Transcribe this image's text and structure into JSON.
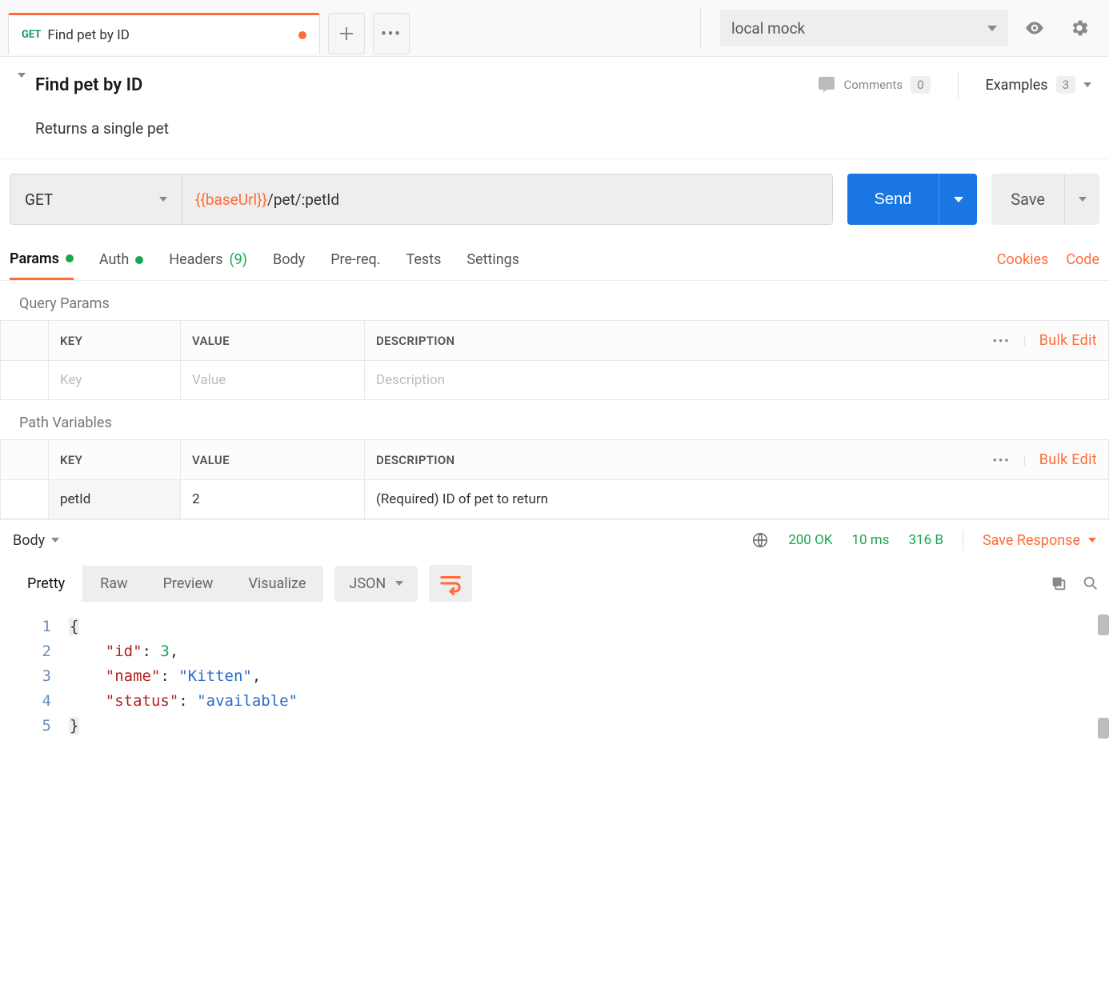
{
  "topbar": {
    "tab": {
      "method": "GET",
      "title": "Find pet by ID"
    },
    "environment": "local mock"
  },
  "title_area": {
    "title": "Find pet by ID",
    "description": "Returns a single pet",
    "comments_label": "Comments",
    "comments_count": "0",
    "examples_label": "Examples",
    "examples_count": "3"
  },
  "url_bar": {
    "method": "GET",
    "url_var": "{{baseUrl}}",
    "url_rest": "/pet/:petId",
    "send": "Send",
    "save": "Save"
  },
  "req_tabs": {
    "params": "Params",
    "auth": "Auth",
    "headers": "Headers",
    "headers_count": "(9)",
    "body": "Body",
    "prereq": "Pre-req.",
    "tests": "Tests",
    "settings": "Settings",
    "cookies": "Cookies",
    "code": "Code"
  },
  "query_params": {
    "section": "Query Params",
    "headers": {
      "key": "KEY",
      "value": "VALUE",
      "description": "DESCRIPTION"
    },
    "bulk_edit": "Bulk Edit",
    "placeholder": {
      "key": "Key",
      "value": "Value",
      "description": "Description"
    }
  },
  "path_vars": {
    "section": "Path Variables",
    "headers": {
      "key": "KEY",
      "value": "VALUE",
      "description": "DESCRIPTION"
    },
    "bulk_edit": "Bulk Edit",
    "row": {
      "key": "petId",
      "value": "2",
      "description": "(Required) ID of pet to return"
    }
  },
  "response_bar": {
    "label": "Body",
    "status": "200 OK",
    "time": "10 ms",
    "size": "316 B",
    "save_response": "Save Response"
  },
  "view_toggle": {
    "pretty": "Pretty",
    "raw": "Raw",
    "preview": "Preview",
    "visualize": "Visualize",
    "format": "JSON"
  },
  "code": {
    "lines": [
      "1",
      "2",
      "3",
      "4",
      "5"
    ],
    "json": {
      "id": 3,
      "name": "Kitten",
      "status": "available"
    }
  }
}
